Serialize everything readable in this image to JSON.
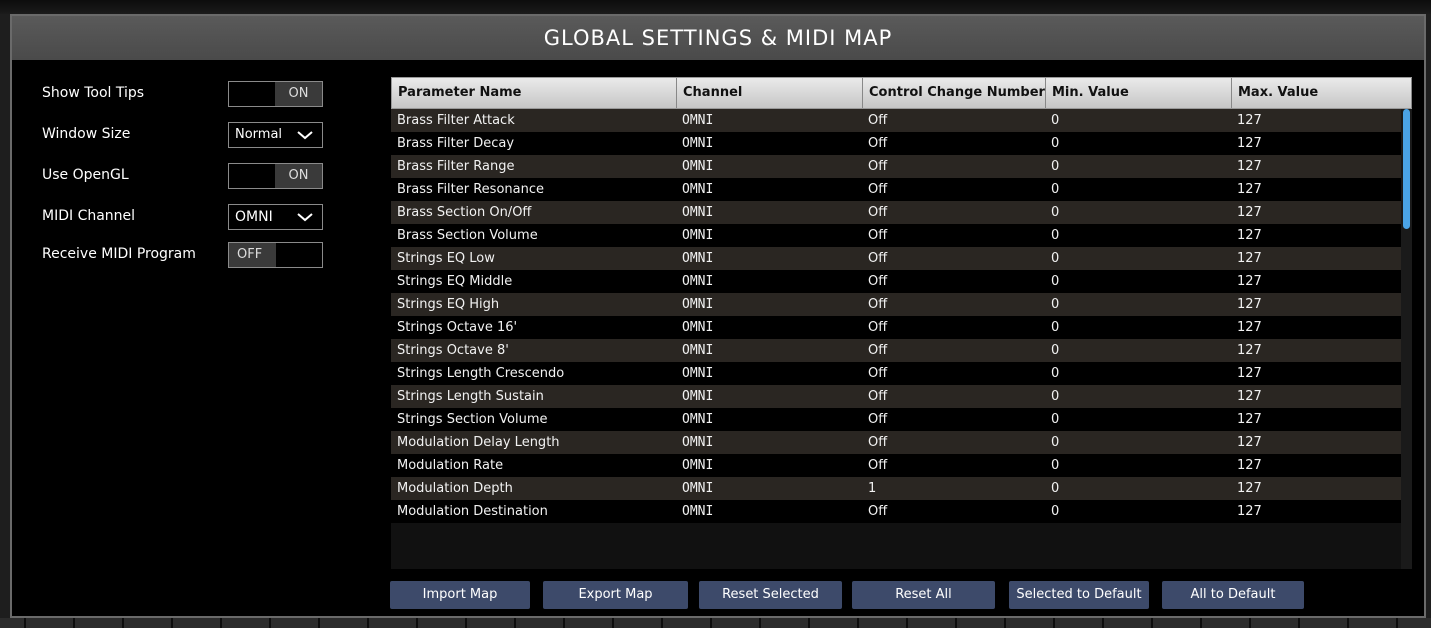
{
  "title": "GLOBAL SETTINGS & MIDI MAP",
  "settings": {
    "show_tool_tips": {
      "label": "Show Tool Tips",
      "value": "ON"
    },
    "window_size": {
      "label": "Window Size",
      "value": "Normal"
    },
    "use_opengl": {
      "label": "Use OpenGL",
      "value": "ON"
    },
    "midi_channel": {
      "label": "MIDI Channel",
      "value": "OMNI"
    },
    "receive_midi_program": {
      "label": "Receive MIDI Program",
      "value": "OFF"
    }
  },
  "table": {
    "headers": [
      "Parameter Name",
      "Channel",
      "Control Change Number",
      "Min. Value",
      "Max. Value"
    ],
    "rows": [
      [
        "Brass Filter Attack",
        "OMNI",
        "Off",
        "0",
        "127"
      ],
      [
        "Brass Filter Decay",
        "OMNI",
        "Off",
        "0",
        "127"
      ],
      [
        "Brass Filter Range",
        "OMNI",
        "Off",
        "0",
        "127"
      ],
      [
        "Brass Filter Resonance",
        "OMNI",
        "Off",
        "0",
        "127"
      ],
      [
        "Brass Section On/Off",
        "OMNI",
        "Off",
        "0",
        "127"
      ],
      [
        "Brass Section Volume",
        "OMNI",
        "Off",
        "0",
        "127"
      ],
      [
        "Strings EQ Low",
        "OMNI",
        "Off",
        "0",
        "127"
      ],
      [
        "Strings EQ Middle",
        "OMNI",
        "Off",
        "0",
        "127"
      ],
      [
        "Strings EQ High",
        "OMNI",
        "Off",
        "0",
        "127"
      ],
      [
        "Strings Octave 16'",
        "OMNI",
        "Off",
        "0",
        "127"
      ],
      [
        "Strings Octave 8'",
        "OMNI",
        "Off",
        "0",
        "127"
      ],
      [
        "Strings Length Crescendo",
        "OMNI",
        "Off",
        "0",
        "127"
      ],
      [
        "Strings Length Sustain",
        "OMNI",
        "Off",
        "0",
        "127"
      ],
      [
        "Strings Section Volume",
        "OMNI",
        "Off",
        "0",
        "127"
      ],
      [
        "Modulation Delay Length",
        "OMNI",
        "Off",
        "0",
        "127"
      ],
      [
        "Modulation Rate",
        "OMNI",
        "Off",
        "0",
        "127"
      ],
      [
        "Modulation Depth",
        "OMNI",
        "1",
        "0",
        "127"
      ],
      [
        "Modulation Destination",
        "OMNI",
        "Off",
        "0",
        "127"
      ]
    ]
  },
  "buttons": {
    "import_map": "Import Map",
    "export_map": "Export Map",
    "reset_selected": "Reset Selected",
    "reset_all": "Reset All",
    "selected_to_default": "Selected to Default",
    "all_to_default": "All to Default"
  },
  "colors": {
    "button_bg": "#3d4a6a",
    "scroll_thumb": "#4aa3e6",
    "title_bg": "#505050"
  }
}
